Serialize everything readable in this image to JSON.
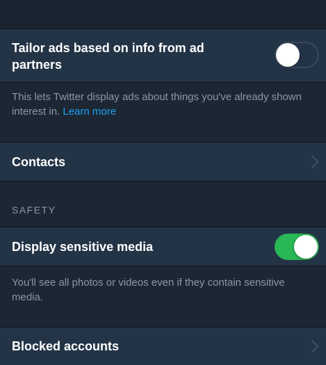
{
  "ads": {
    "tailor_label": "Tailor ads based on info from ad partners",
    "tailor_enabled": false,
    "description_text": "This lets Twitter display ads about things you've already shown interest in.",
    "learn_more_label": "Learn more"
  },
  "contacts": {
    "label": "Contacts",
    "icon": "chevron-right-icon"
  },
  "safety": {
    "header": "SAFETY",
    "sensitive_label": "Display sensitive media",
    "sensitive_enabled": true,
    "sensitive_description": "You'll see all photos or videos even if they contain sensitive media."
  },
  "blocked": {
    "label": "Blocked accounts",
    "icon": "chevron-right-icon"
  },
  "colors": {
    "background": "#1c2733",
    "cell_background": "#243447",
    "toggle_on": "#2ab755",
    "link": "#1da1f2",
    "secondary_text": "#8899a6"
  }
}
